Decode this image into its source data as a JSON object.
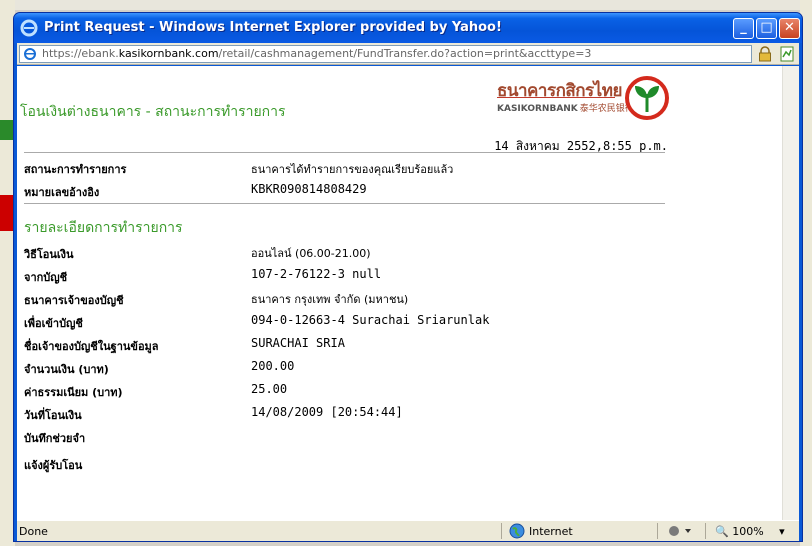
{
  "window": {
    "title": "Print Request - Windows Internet Explorer provided by Yahoo!",
    "minimize": "_",
    "maximize": "□",
    "close": "✕"
  },
  "address": {
    "prefix": "https://ebank.",
    "domain": "kasikornbank.com",
    "path": "/retail/cashmanagement/FundTransfer.do?action=print&accttype=3"
  },
  "page": {
    "title": "โอนเงินต่างธนาคาร - สถานะการทำรายการ",
    "logo_th": "ธนาคารกสิกรไทย",
    "logo_en": "KASIKORNBANK",
    "logo_cn": "泰华农民银行",
    "date": "14 สิงหาคม 2552,8:55 p.m.",
    "status_rows": [
      {
        "label": "สถานะการทำรายการ",
        "value": "ธนาคารได้ทำรายการของคุณเรียบร้อยแล้ว"
      },
      {
        "label": "หมายเลขอ้างอิง",
        "value": "KBKR090814808429"
      }
    ],
    "section_title": "รายละเอียดการทำรายการ",
    "detail_rows": [
      {
        "label": "วิธีโอนเงิน",
        "value": "ออนไลน์ (06.00-21.00)"
      },
      {
        "label": "จากบัญชี",
        "value": "107-2-76122-3 null"
      },
      {
        "label": "ธนาคารเจ้าของบัญชี",
        "value": "ธนาคาร กรุงเทพ จำกัด (มหาชน)"
      },
      {
        "label": "เพื่อเข้าบัญชี",
        "value": "094-0-12663-4 Surachai Sriarunlak"
      },
      {
        "label": "ชื่อเจ้าของบัญชีในฐานข้อมูล",
        "value": "SURACHAI SRIA"
      },
      {
        "label": "จำนวนเงิน (บาท)",
        "value": "200.00"
      },
      {
        "label": "ค่าธรรมเนียม (บาท)",
        "value": "25.00"
      },
      {
        "label": "วันที่โอนเงิน",
        "value": "14/08/2009 [20:54:44]"
      },
      {
        "label": "บันทึกช่วยจำ",
        "value": ""
      },
      {
        "label": "แจ้งผู้รับโอน",
        "value": ""
      }
    ]
  },
  "status": {
    "left": "Done",
    "zone": "Internet",
    "zoom": "100%"
  },
  "colors": {
    "title_green": "#3a9a2a",
    "brand_red": "#a2492f",
    "xp_blue": "#0a59d6"
  }
}
